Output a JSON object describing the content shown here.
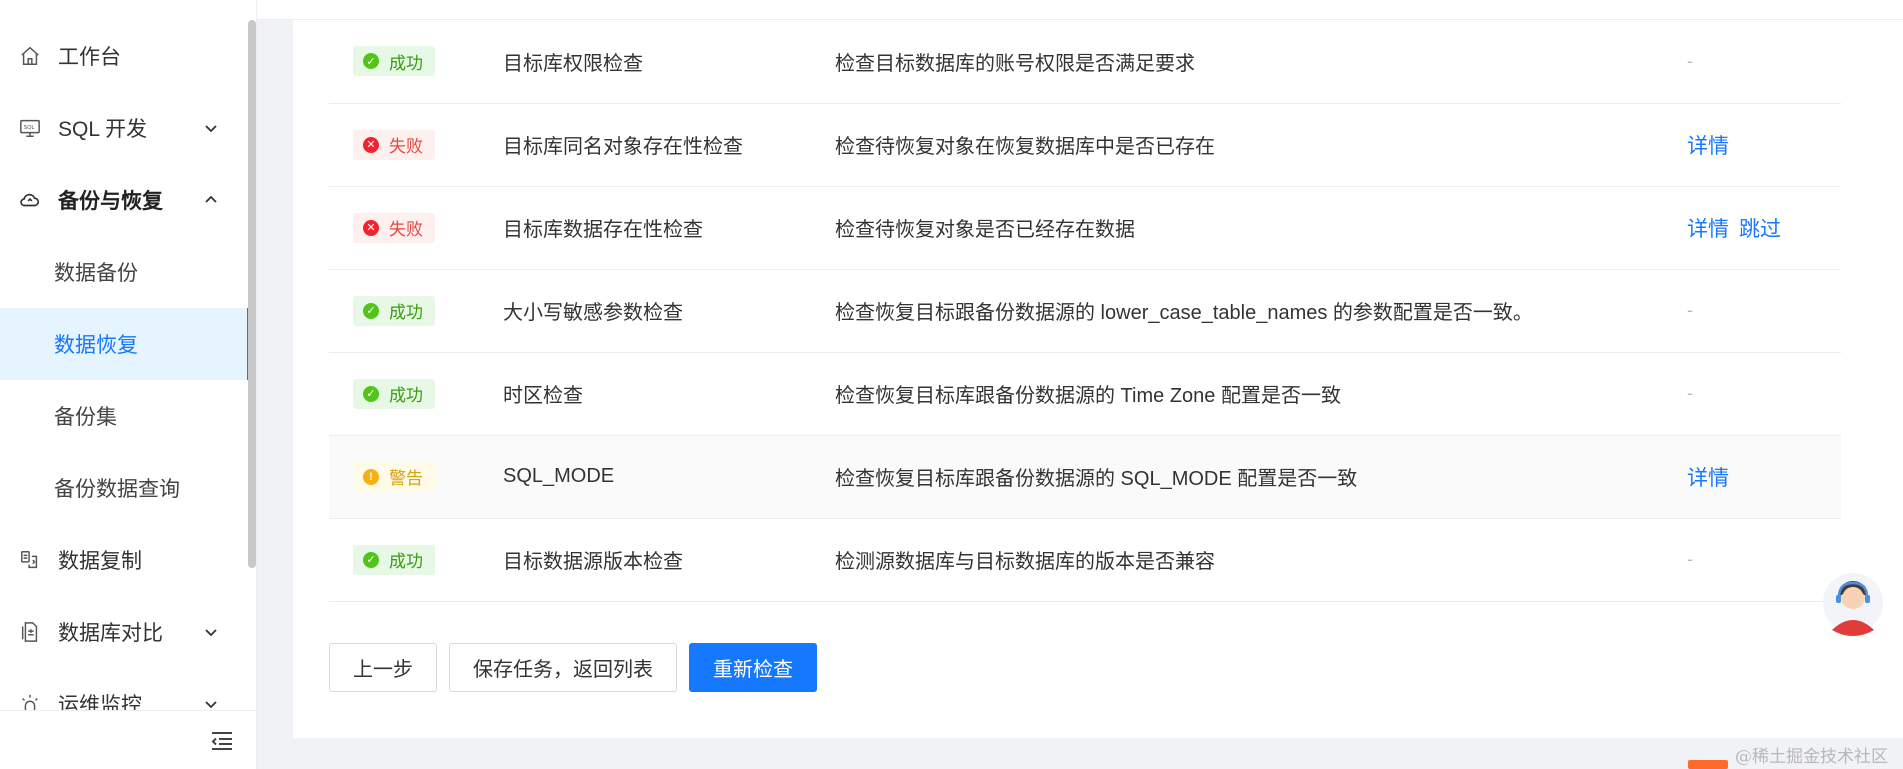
{
  "sidebar": {
    "items": [
      {
        "label": "工作台",
        "icon": "home-icon",
        "state": "plain"
      },
      {
        "label": "SQL 开发",
        "icon": "sql-monitor-icon",
        "state": "collapsed"
      },
      {
        "label": "备份与恢复",
        "icon": "cloud-sync-icon",
        "state": "expanded"
      }
    ],
    "subitems": [
      {
        "label": "数据备份",
        "active": false
      },
      {
        "label": "数据恢复",
        "active": true
      },
      {
        "label": "备份集",
        "active": false
      },
      {
        "label": "备份数据查询",
        "active": false
      }
    ],
    "items_after": [
      {
        "label": "数据复制",
        "icon": "copy-data-icon",
        "state": "plain"
      },
      {
        "label": "数据库对比",
        "icon": "compare-doc-icon",
        "state": "collapsed"
      },
      {
        "label": "运维监控",
        "icon": "monitor-bulb-icon",
        "state": "collapsed"
      }
    ],
    "collapse_icon": "menu-fold-icon"
  },
  "checks": {
    "rows": [
      {
        "status": "成功",
        "type": "ok",
        "name": "目标库权限检查",
        "desc": "检查目标数据库的账号权限是否满足要求",
        "actions": [],
        "empty": "-"
      },
      {
        "status": "失败",
        "type": "fail",
        "name": "目标库同名对象存在性检查",
        "desc": "检查待恢复对象在恢复数据库中是否已存在",
        "actions": [
          "详情"
        ],
        "empty": ""
      },
      {
        "status": "失败",
        "type": "fail",
        "name": "目标库数据存在性检查",
        "desc": "检查待恢复对象是否已经存在数据",
        "actions": [
          "详情",
          "跳过"
        ],
        "empty": ""
      },
      {
        "status": "成功",
        "type": "ok",
        "name": "大小写敏感参数检查",
        "desc": "检查恢复目标跟备份数据源的 lower_case_table_names 的参数配置是否一致。",
        "actions": [],
        "empty": "-"
      },
      {
        "status": "成功",
        "type": "ok",
        "name": "时区检查",
        "desc": "检查恢复目标库跟备份数据源的 Time Zone 配置是否一致",
        "actions": [],
        "empty": "-"
      },
      {
        "status": "警告",
        "type": "warn",
        "name": "SQL_MODE",
        "desc": "检查恢复目标库跟备份数据源的 SQL_MODE 配置是否一致",
        "actions": [
          "详情"
        ],
        "empty": ""
      },
      {
        "status": "成功",
        "type": "ok",
        "name": "目标数据源版本检查",
        "desc": "检测源数据库与目标数据库的版本是否兼容",
        "actions": [],
        "empty": "-"
      }
    ]
  },
  "buttons": {
    "prev": "上一步",
    "save": "保存任务，返回列表",
    "recheck": "重新检查"
  },
  "colors": {
    "primary": "#1677ff",
    "success": "#52c41a",
    "fail": "#f5222d",
    "warn": "#faad14"
  },
  "watermark": "@稀土掘金技术社区"
}
